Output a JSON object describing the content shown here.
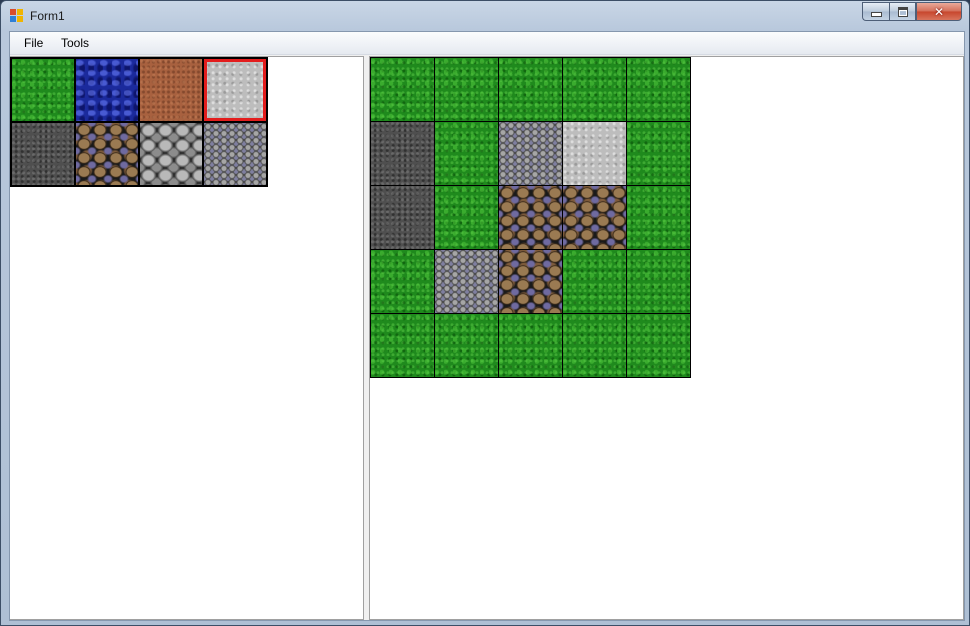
{
  "window": {
    "title": "Form1"
  },
  "menu": {
    "file": "File",
    "tools": "Tools"
  },
  "palette": {
    "tiles": [
      "grass",
      "water",
      "dirt",
      "concrete",
      "asphalt",
      "pebbles",
      "stones",
      "gravel"
    ],
    "selected": "concrete"
  },
  "map": {
    "rows": [
      [
        "grass",
        "grass",
        "grass",
        "grass",
        "grass"
      ],
      [
        "asphalt",
        "grass",
        "gravel",
        "concrete",
        "grass"
      ],
      [
        "asphalt",
        "grass",
        "pebbles",
        "pebbles",
        "grass"
      ],
      [
        "grass",
        "gravel",
        "pebbles",
        "grass",
        "grass"
      ],
      [
        "grass",
        "grass",
        "grass",
        "grass",
        "grass"
      ]
    ]
  }
}
